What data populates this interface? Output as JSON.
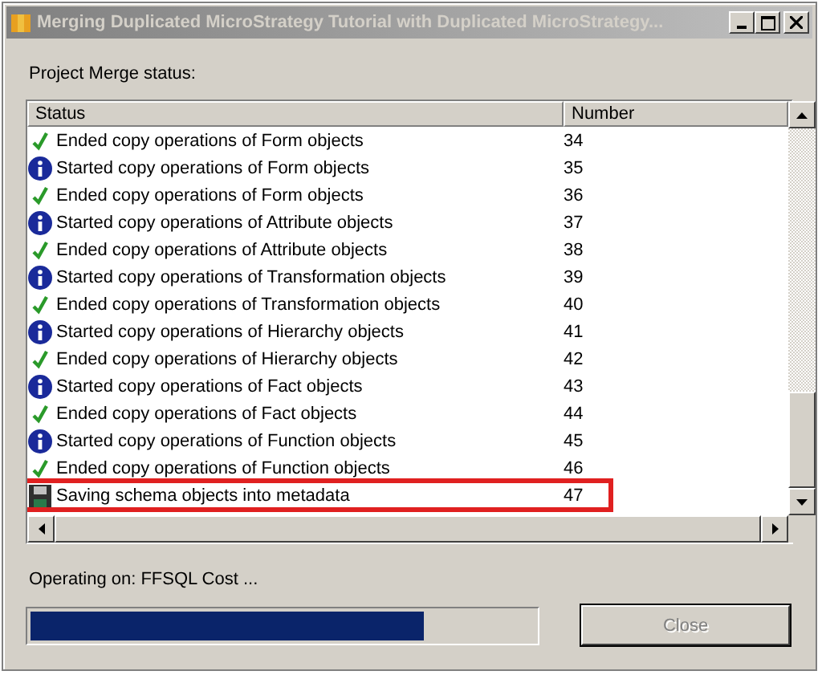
{
  "window": {
    "title": "Merging Duplicated MicroStrategy Tutorial with Duplicated MicroStrategy..."
  },
  "status_label": "Project Merge status:",
  "table": {
    "columns": [
      "Status",
      "Number"
    ],
    "rows": [
      {
        "kind": "ended",
        "status": "Ended copy operations of Form objects",
        "number": "34",
        "highlighted": false
      },
      {
        "kind": "started",
        "status": "Started copy operations of Form objects",
        "number": "35",
        "highlighted": false
      },
      {
        "kind": "ended",
        "status": "Ended copy operations of Form objects",
        "number": "36",
        "highlighted": false
      },
      {
        "kind": "started",
        "status": "Started copy operations of Attribute objects",
        "number": "37",
        "highlighted": false
      },
      {
        "kind": "ended",
        "status": "Ended copy operations of Attribute objects",
        "number": "38",
        "highlighted": false
      },
      {
        "kind": "started",
        "status": "Started copy operations of Transformation objects",
        "number": "39",
        "highlighted": false
      },
      {
        "kind": "ended",
        "status": "Ended copy operations of Transformation objects",
        "number": "40",
        "highlighted": false
      },
      {
        "kind": "started",
        "status": "Started copy operations of Hierarchy objects",
        "number": "41",
        "highlighted": false
      },
      {
        "kind": "ended",
        "status": "Ended copy operations of Hierarchy objects",
        "number": "42",
        "highlighted": false
      },
      {
        "kind": "started",
        "status": "Started copy operations of Fact objects",
        "number": "43",
        "highlighted": false
      },
      {
        "kind": "ended",
        "status": "Ended copy operations of Fact objects",
        "number": "44",
        "highlighted": false
      },
      {
        "kind": "started",
        "status": "Started copy operations of Function objects",
        "number": "45",
        "highlighted": false
      },
      {
        "kind": "ended",
        "status": "Ended copy operations of Function objects",
        "number": "46",
        "highlighted": false
      },
      {
        "kind": "saving",
        "status": "Saving schema objects into metadata",
        "number": "47",
        "highlighted": true
      }
    ]
  },
  "operating": "Operating on: FFSQL Cost ...",
  "progress": {
    "level": 0.78
  },
  "close_button": {
    "label": "Close",
    "disabled": true
  }
}
